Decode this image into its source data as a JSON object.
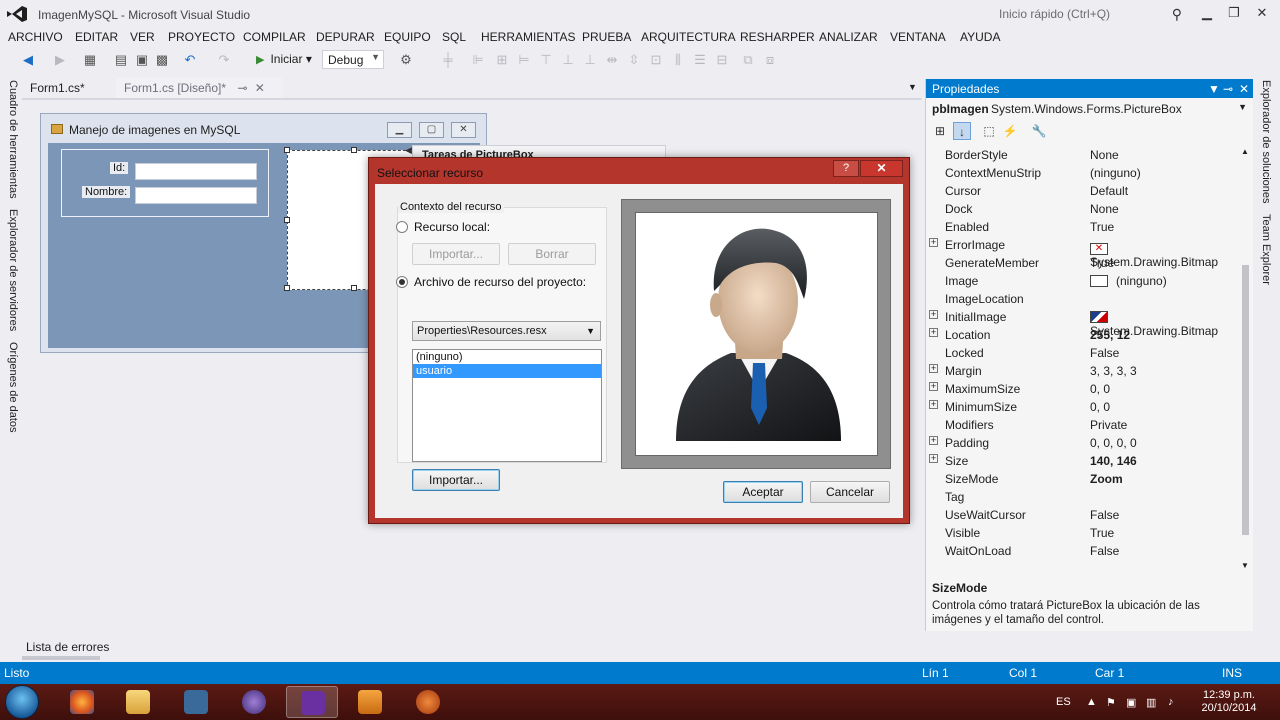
{
  "window": {
    "title": "ImagenMySQL - Microsoft Visual Studio"
  },
  "quick_launch": {
    "placeholder": "Inicio rápido (Ctrl+Q)"
  },
  "menu": [
    "ARCHIVO",
    "EDITAR",
    "VER",
    "PROYECTO",
    "COMPILAR",
    "DEPURAR",
    "EQUIPO",
    "SQL",
    "HERRAMIENTAS",
    "PRUEBA",
    "ARQUITECTURA",
    "RESHARPER",
    "ANALIZAR",
    "VENTANA",
    "AYUDA"
  ],
  "toolbar": {
    "run_label": "Iniciar",
    "config": "Debug"
  },
  "left_tabs": [
    "Cuadro de herramientas",
    "Explorador de servidores",
    "Orígenes de datos"
  ],
  "right_tabs": [
    "Explorador de soluciones",
    "Team Explorer"
  ],
  "doc_tabs": [
    "Form1.cs*",
    "Form1.cs [Diseño]*"
  ],
  "designer": {
    "form_title": "Manejo de imagenes en MySQL",
    "id_label": "Id:",
    "name_label": "Nombre:",
    "smart_tag_title": "Tareas de PictureBox"
  },
  "dialog": {
    "title": "Seleccionar recurso",
    "help": "?",
    "close": "✕",
    "group_label": "Contexto del recurso",
    "local_label": "Recurso local:",
    "import_local": "Importar...",
    "delete": "Borrar",
    "project_label": "Archivo de recurso del proyecto:",
    "resx_file": "Properties\\Resources.resx",
    "resources": [
      "(ninguno)",
      "usuario"
    ],
    "selected_resource": "usuario",
    "import_button": "Importar...",
    "ok": "Aceptar",
    "cancel": "Cancelar"
  },
  "properties": {
    "title": "Propiedades",
    "object_name": "pbImagen",
    "object_type": "System.Windows.Forms.PictureBox",
    "rows": [
      {
        "name": "BorderStyle",
        "value": "None",
        "expandable": false
      },
      {
        "name": "ContextMenuStrip",
        "value": "(ninguno)",
        "expandable": false
      },
      {
        "name": "Cursor",
        "value": "Default",
        "expandable": false
      },
      {
        "name": "Dock",
        "value": "None",
        "expandable": false
      },
      {
        "name": "Enabled",
        "value": "True",
        "expandable": false
      },
      {
        "name": "ErrorImage",
        "value": "System.Drawing.Bitmap",
        "expandable": true,
        "swatch": "err"
      },
      {
        "name": "GenerateMember",
        "value": "True",
        "expandable": false
      },
      {
        "name": "Image",
        "value": "(ninguno)",
        "expandable": false,
        "swatch": "blank"
      },
      {
        "name": "ImageLocation",
        "value": "",
        "expandable": false
      },
      {
        "name": "InitialImage",
        "value": "System.Drawing.Bitmap",
        "expandable": true,
        "swatch": "img"
      },
      {
        "name": "Location",
        "value": "255, 12",
        "expandable": true,
        "bold": true
      },
      {
        "name": "Locked",
        "value": "False",
        "expandable": false
      },
      {
        "name": "Margin",
        "value": "3, 3, 3, 3",
        "expandable": true
      },
      {
        "name": "MaximumSize",
        "value": "0, 0",
        "expandable": true
      },
      {
        "name": "MinimumSize",
        "value": "0, 0",
        "expandable": true
      },
      {
        "name": "Modifiers",
        "value": "Private",
        "expandable": false
      },
      {
        "name": "Padding",
        "value": "0, 0, 0, 0",
        "expandable": true
      },
      {
        "name": "Size",
        "value": "140, 146",
        "expandable": true,
        "bold": true
      },
      {
        "name": "SizeMode",
        "value": "Zoom",
        "expandable": false,
        "bold": true,
        "selected": true
      },
      {
        "name": "Tag",
        "value": "",
        "expandable": false
      },
      {
        "name": "UseWaitCursor",
        "value": "False",
        "expandable": false
      },
      {
        "name": "Visible",
        "value": "True",
        "expandable": false
      },
      {
        "name": "WaitOnLoad",
        "value": "False",
        "expandable": false
      }
    ],
    "desc_title": "SizeMode",
    "desc_text": "Controla cómo tratará PictureBox la ubicación de las imágenes y el tamaño del control."
  },
  "bottom": {
    "error_list": "Lista de errores"
  },
  "status": {
    "ready": "Listo",
    "line": "Lín 1",
    "col": "Col 1",
    "car": "Car 1",
    "ins": "INS"
  },
  "taskbar": {
    "lang": "ES",
    "time": "12:39 p.m.",
    "date": "20/10/2014"
  },
  "colors": {
    "accent": "#007acc",
    "dialog_border": "#b3352c",
    "taskbar": "#4a130e"
  }
}
